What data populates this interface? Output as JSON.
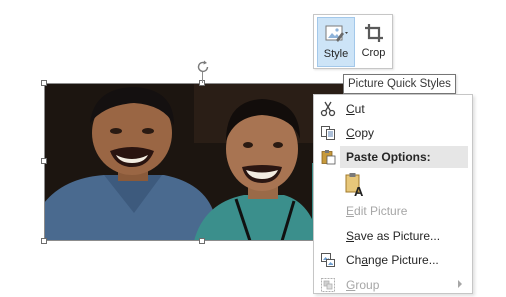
{
  "mini_toolbar": {
    "style_label": "Style",
    "crop_label": "Crop"
  },
  "tooltip": {
    "text": "Picture Quick Styles"
  },
  "context_menu": {
    "cut": {
      "accel": "C",
      "rest": "ut"
    },
    "copy": {
      "accel": "C",
      "rest": "opy"
    },
    "paste_options_header": "Paste Options:",
    "edit_picture": {
      "accel": "E",
      "rest": "dit Picture"
    },
    "save_as_picture": {
      "pre": "",
      "accel": "S",
      "rest": "ave as Picture..."
    },
    "change_picture": {
      "pre": "Ch",
      "accel": "a",
      "rest": "nge Picture..."
    },
    "group": {
      "accel": "G",
      "rest": "roup"
    }
  },
  "icons": {
    "style": "picture-style-icon",
    "crop": "crop-icon",
    "cut": "scissors-icon",
    "copy": "copy-icon",
    "paste": "clipboard-icon",
    "paste_option": "paste-keep-text-icon",
    "edit_picture": "edit-picture-icon",
    "change_picture": "change-picture-icon",
    "group": "group-icon",
    "rotate": "rotate-handle-icon"
  },
  "colors": {
    "accent_selected": "#cde4f7",
    "menu_header_bg": "#e6e6e6",
    "disabled_text": "#a6a6a6"
  }
}
